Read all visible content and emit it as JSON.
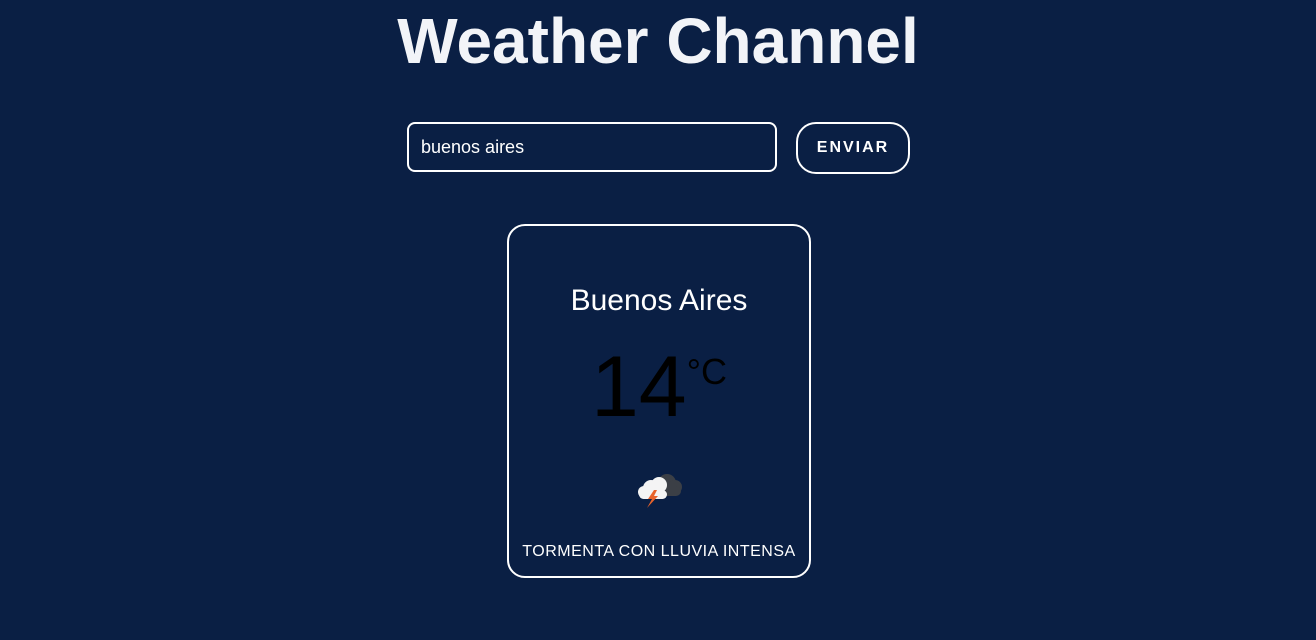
{
  "header": {
    "title": "Weather Channel"
  },
  "search": {
    "value": "buenos aires",
    "button_label": "ENVIAR"
  },
  "weather": {
    "city": "Buenos Aires",
    "temperature": "14",
    "unit": "°C",
    "icon": "thunderstorm-rain-icon",
    "description": "TORMENTA CON LLUVIA INTENSA"
  },
  "colors": {
    "background": "#0a1f44",
    "border": "#ffffff",
    "text": "#ffffff",
    "temperature_text": "#000000"
  }
}
